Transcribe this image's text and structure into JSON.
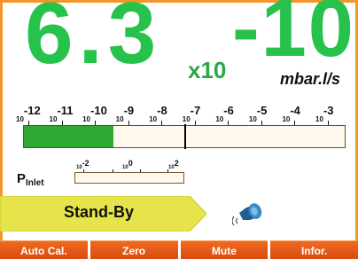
{
  "reading": {
    "mantissa": "6.3",
    "multiplier": "x10",
    "exponent": "-10",
    "unit": "mbar.l/s"
  },
  "leak_scale": {
    "base": "10",
    "exponents": [
      "-12",
      "-11",
      "-10",
      "-9",
      "-8",
      "-7",
      "-6",
      "-5",
      "-4",
      "-3"
    ],
    "fill_fraction": 0.28,
    "marker_fraction": 0.5
  },
  "inlet": {
    "label_main": "P",
    "label_sub": "Inlet",
    "base": "10",
    "exponents": [
      "-2",
      "0",
      "2"
    ]
  },
  "status": {
    "text": "Stand-By"
  },
  "icons": {
    "audio": "speaker-icon"
  },
  "buttons": {
    "auto_cal": "Auto Cal.",
    "zero": "Zero",
    "mute": "Mute",
    "info": "Infor."
  },
  "colors": {
    "accent": "#f2962a",
    "reading": "#27c24c",
    "bar_fill": "#2ea832",
    "status_bg": "#e6e44a",
    "button": "#e05a18"
  }
}
